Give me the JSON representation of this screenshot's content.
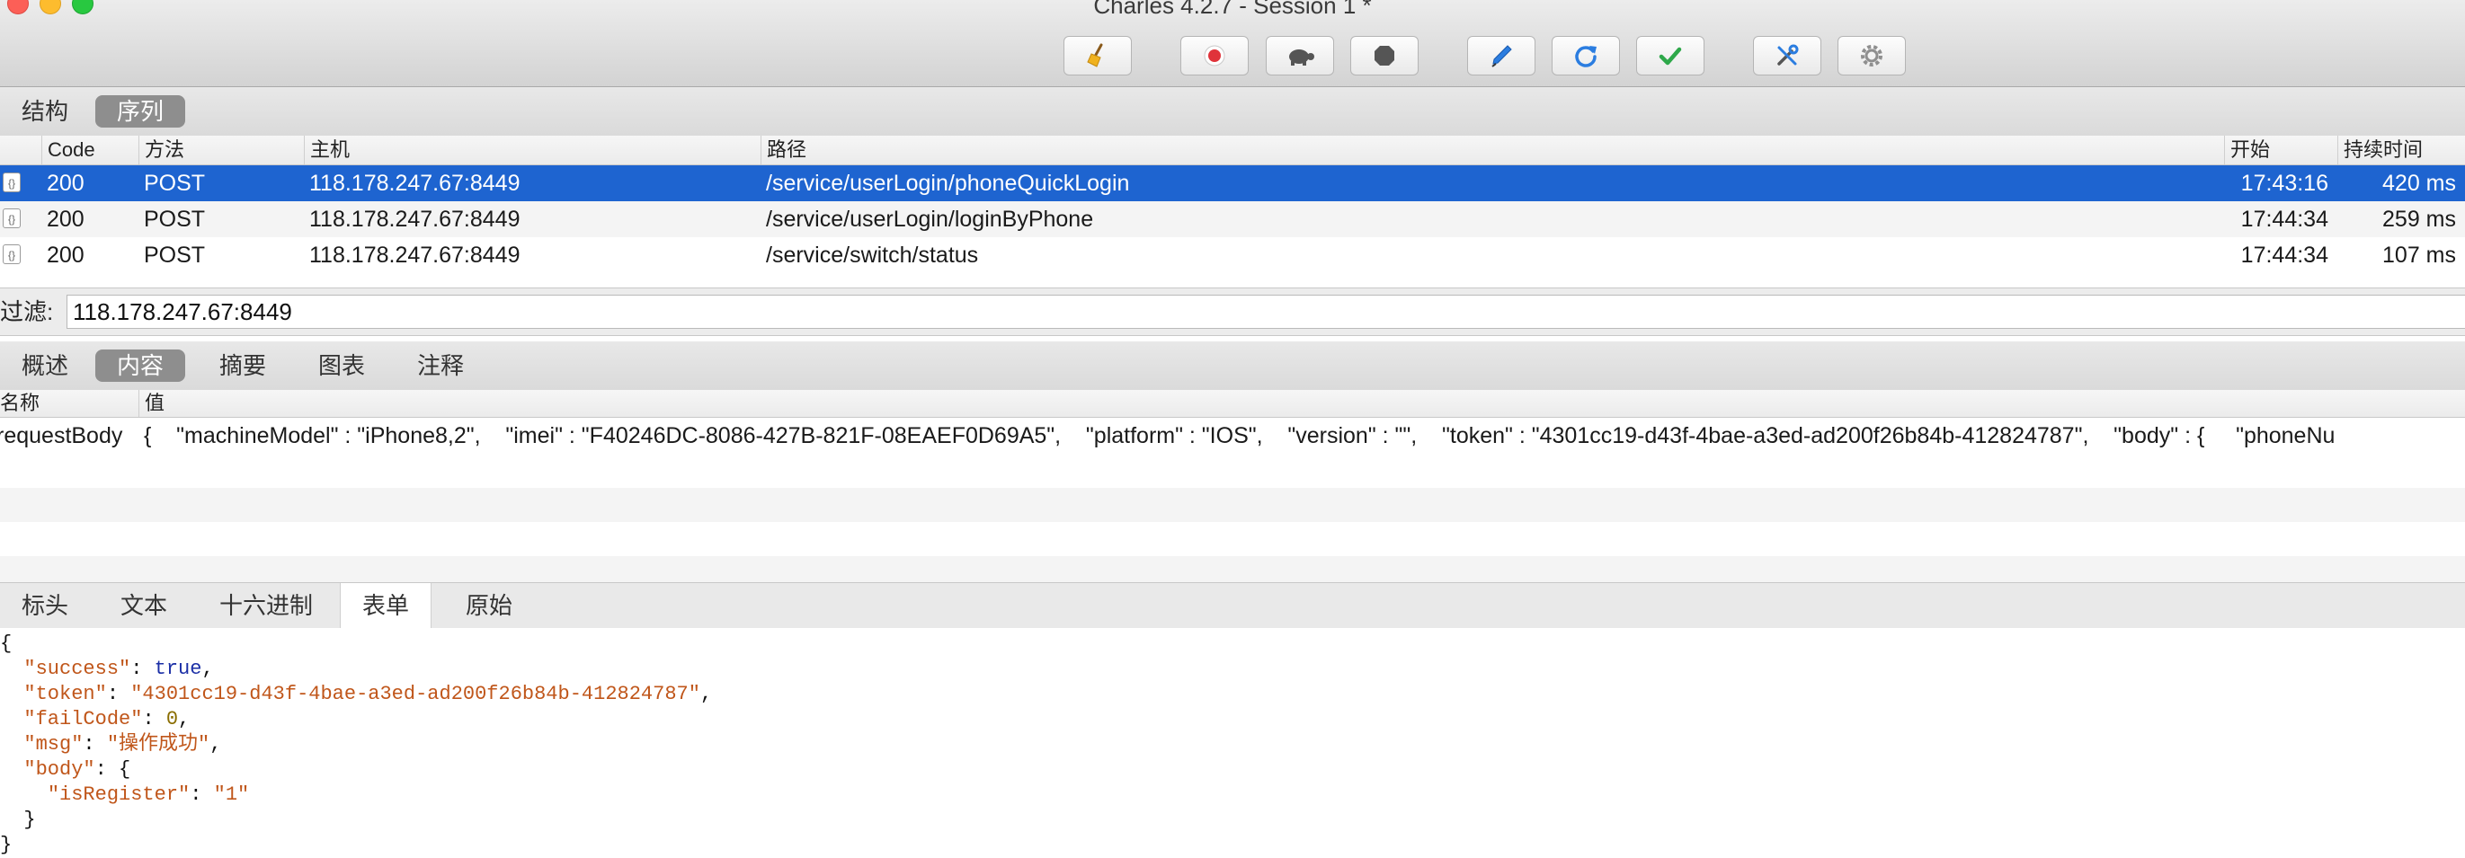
{
  "window": {
    "title": "Charles 4.2.7 - Session 1 *"
  },
  "toolbar": {
    "buttons": [
      {
        "icon": "broom-icon"
      },
      {
        "icon": "record-icon",
        "color": "#e0333a"
      },
      {
        "icon": "turtle-icon"
      },
      {
        "icon": "stop-hexagon-icon"
      },
      {
        "icon": "pen-icon",
        "color": "#2b7de0"
      },
      {
        "icon": "refresh-icon",
        "color": "#2b7de0"
      },
      {
        "icon": "checkmark-icon",
        "color": "#2ea84a"
      },
      {
        "icon": "tools-icon"
      },
      {
        "icon": "gear-icon"
      }
    ]
  },
  "view_tabs": [
    "结构",
    "序列"
  ],
  "request_table": {
    "columns": [
      "Code",
      "方法",
      "主机",
      "路径",
      "开始",
      "持续时间"
    ],
    "rows": [
      {
        "code": "200",
        "method": "POST",
        "host": "118.178.247.67:8449",
        "path": "/service/userLogin/phoneQuickLogin",
        "start": "17:43:16",
        "duration": "420 ms"
      },
      {
        "code": "200",
        "method": "POST",
        "host": "118.178.247.67:8449",
        "path": "/service/userLogin/loginByPhone",
        "start": "17:44:34",
        "duration": "259 ms"
      },
      {
        "code": "200",
        "method": "POST",
        "host": "118.178.247.67:8449",
        "path": "/service/switch/status",
        "start": "17:44:34",
        "duration": "107 ms"
      }
    ],
    "selected_color": "#1e64d0"
  },
  "filter": {
    "label": "过滤:",
    "value": "118.178.247.67:8449"
  },
  "detail_tabs": [
    "概述",
    "内容",
    "摘要",
    "图表",
    "注释"
  ],
  "name_value": {
    "columns": [
      "名称",
      "值"
    ],
    "row": {
      "name": "requestBody",
      "value": "{    \"machineModel\" : \"iPhone8,2\",    \"imei\" : \"F40246DC-8086-427B-821F-08EAEF0D69A5\",    \"platform\" : \"IOS\",    \"version\" : \"\",    \"token\" : \"4301cc19-d43f-4bae-a3ed-ad200f26b84b-412824787\",    \"body\" : {     \"phoneNu"
    }
  },
  "bottom_tabs": [
    "标头",
    "文本",
    "十六进制",
    "表单",
    "原始"
  ],
  "json": {
    "open": "{",
    "k_success": "\"success\"",
    "v_success": "true",
    "k_token": "\"token\"",
    "v_token": "\"4301cc19-d43f-4bae-a3ed-ad200f26b84b-412824787\"",
    "k_failCode": "\"failCode\"",
    "v_failCode": "0",
    "k_msg": "\"msg\"",
    "v_msg": "\"操作成功\"",
    "k_body": "\"body\"",
    "v_body_open": "{",
    "k_isRegister": "\"isRegister\"",
    "v_isRegister": "\"1\"",
    "body_close": "}",
    "close": "}"
  }
}
